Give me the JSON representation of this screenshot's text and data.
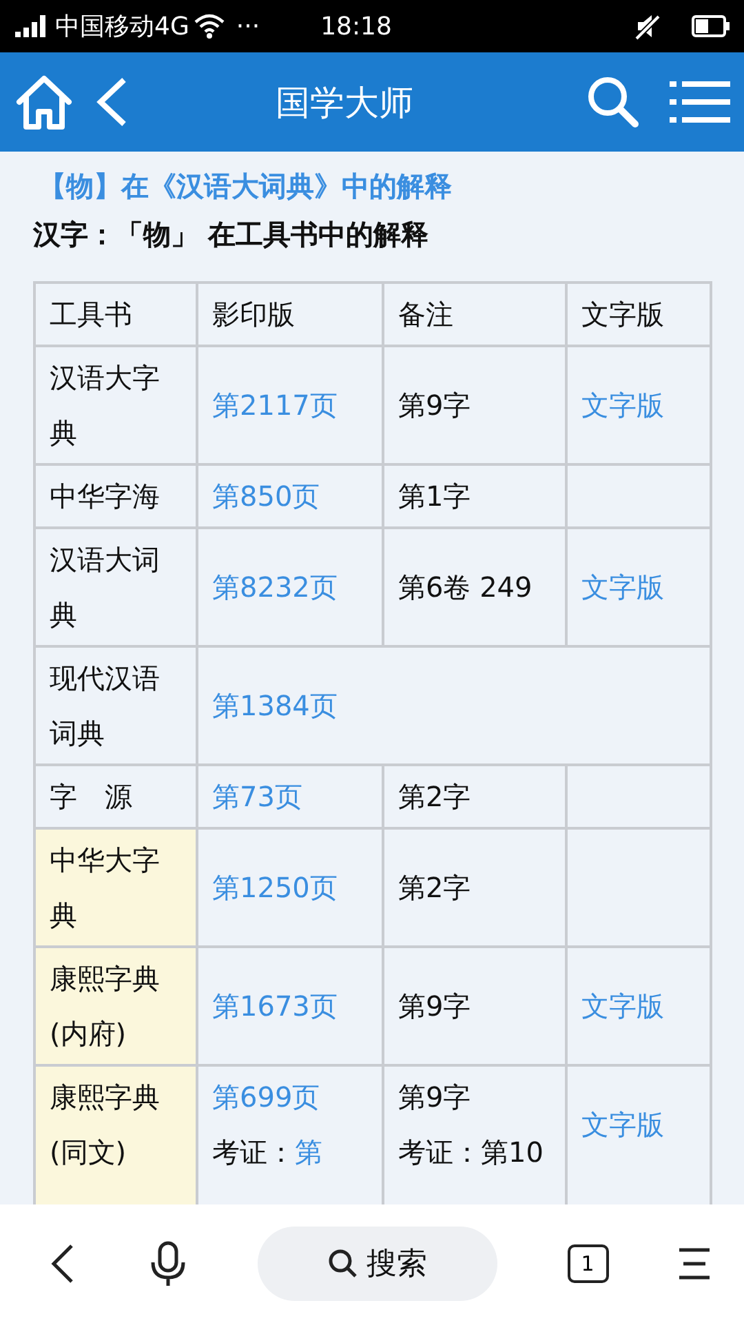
{
  "status_bar": {
    "carrier": "中国移动4G",
    "more": "···",
    "time": "18:18"
  },
  "header": {
    "title": "国学大师"
  },
  "heading_link": "【物】在《汉语大词典》中的解释",
  "subtitle": "汉字：「物」 在工具书中的解释",
  "table": {
    "columns": [
      "工具书",
      "影印版",
      "备注",
      "文字版"
    ],
    "rows": [
      {
        "highlighted": false,
        "cells": [
          {
            "lines": [
              [
                {
                  "text": "汉语大字典",
                  "link": false
                }
              ]
            ]
          },
          {
            "lines": [
              [
                {
                  "text": "第2117页",
                  "link": true
                }
              ]
            ]
          },
          {
            "lines": [
              [
                {
                  "text": "第9字",
                  "link": false
                }
              ]
            ]
          },
          {
            "lines": [
              [
                {
                  "text": "文字版",
                  "link": true
                }
              ]
            ]
          }
        ]
      },
      {
        "highlighted": false,
        "cells": [
          {
            "lines": [
              [
                {
                  "text": "中华字海",
                  "link": false
                }
              ]
            ]
          },
          {
            "lines": [
              [
                {
                  "text": "第850页",
                  "link": true
                }
              ]
            ]
          },
          {
            "lines": [
              [
                {
                  "text": "第1字",
                  "link": false
                }
              ]
            ]
          },
          {}
        ]
      },
      {
        "highlighted": false,
        "cells": [
          {
            "lines": [
              [
                {
                  "text": "汉语大词典",
                  "link": false
                }
              ]
            ]
          },
          {
            "lines": [
              [
                {
                  "text": "第8232页",
                  "link": true
                }
              ]
            ]
          },
          {
            "lines": [
              [
                {
                  "text": "第6卷 249",
                  "link": false
                }
              ]
            ]
          },
          {
            "lines": [
              [
                {
                  "text": "文字版",
                  "link": true
                }
              ]
            ]
          }
        ]
      },
      {
        "highlighted": false,
        "cells": [
          {
            "lines": [
              [
                {
                  "text": "现代汉语词典",
                  "link": false
                }
              ]
            ]
          },
          {
            "colspan": 3,
            "lines": [
              [
                {
                  "text": "第1384页",
                  "link": true
                }
              ]
            ]
          }
        ]
      },
      {
        "highlighted": false,
        "cells": [
          {
            "lines": [
              [
                {
                  "text": "字　源",
                  "link": false
                }
              ]
            ]
          },
          {
            "lines": [
              [
                {
                  "text": "第73页",
                  "link": true
                }
              ]
            ]
          },
          {
            "lines": [
              [
                {
                  "text": "第2字",
                  "link": false
                }
              ]
            ]
          },
          {}
        ]
      },
      {
        "highlighted": true,
        "cells": [
          {
            "lines": [
              [
                {
                  "text": "中华大字典",
                  "link": false
                }
              ]
            ]
          },
          {
            "lines": [
              [
                {
                  "text": "第1250页",
                  "link": true
                }
              ]
            ]
          },
          {
            "lines": [
              [
                {
                  "text": "第2字",
                  "link": false
                }
              ]
            ]
          },
          {}
        ]
      },
      {
        "highlighted": true,
        "cells": [
          {
            "lines": [
              [
                {
                  "text": "康熙字典(内府)",
                  "link": false
                }
              ]
            ]
          },
          {
            "lines": [
              [
                {
                  "text": "第1673页",
                  "link": true
                }
              ]
            ]
          },
          {
            "lines": [
              [
                {
                  "text": "第9字",
                  "link": false
                }
              ]
            ]
          },
          {
            "lines": [
              [
                {
                  "text": "文字版",
                  "link": true
                }
              ]
            ]
          }
        ]
      },
      {
        "highlighted": true,
        "cells": [
          {
            "lines": [
              [
                {
                  "text": "康熙字典(同文)",
                  "link": false
                }
              ]
            ]
          },
          {
            "lines": [
              [
                {
                  "text": "第699页",
                  "link": true
                }
              ],
              [
                {
                  "text": "考证：",
                  "link": false
                },
                {
                  "text": "第",
                  "link": true
                }
              ]
            ]
          },
          {
            "lines": [
              [
                {
                  "text": "第9字",
                  "link": false
                }
              ],
              [
                {
                  "text": "考证：第10",
                  "link": false
                }
              ]
            ]
          },
          {
            "lines": [
              [
                {
                  "text": "文字版",
                  "link": true
                }
              ]
            ]
          }
        ]
      }
    ]
  },
  "bottom_bar": {
    "search": "搜索",
    "tab_count": "1"
  }
}
